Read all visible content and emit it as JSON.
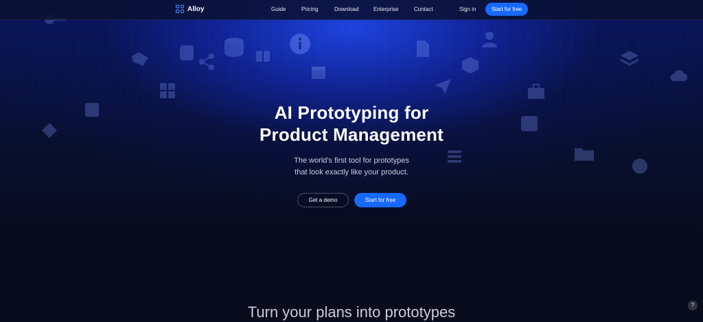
{
  "header": {
    "logo_text": "Alloy",
    "nav": [
      {
        "label": "Guide"
      },
      {
        "label": "Pricing"
      },
      {
        "label": "Download"
      },
      {
        "label": "Enterprise"
      },
      {
        "label": "Contact"
      }
    ],
    "sign_in_label": "Sign in",
    "cta_label": "Start for free"
  },
  "hero": {
    "title_line1": "AI Prototyping for",
    "title_line2": "Product Management",
    "subtitle_line1": "The world's first tool for prototypes",
    "subtitle_line2": "that look exactly like your product.",
    "demo_button": "Get a demo",
    "start_button": "Start for free"
  },
  "next_section": {
    "heading": "Turn your plans into prototypes"
  },
  "help": {
    "label": "?"
  },
  "colors": {
    "accent": "#1769ff",
    "background": "#070b1c",
    "glow": "#1e46e6"
  }
}
